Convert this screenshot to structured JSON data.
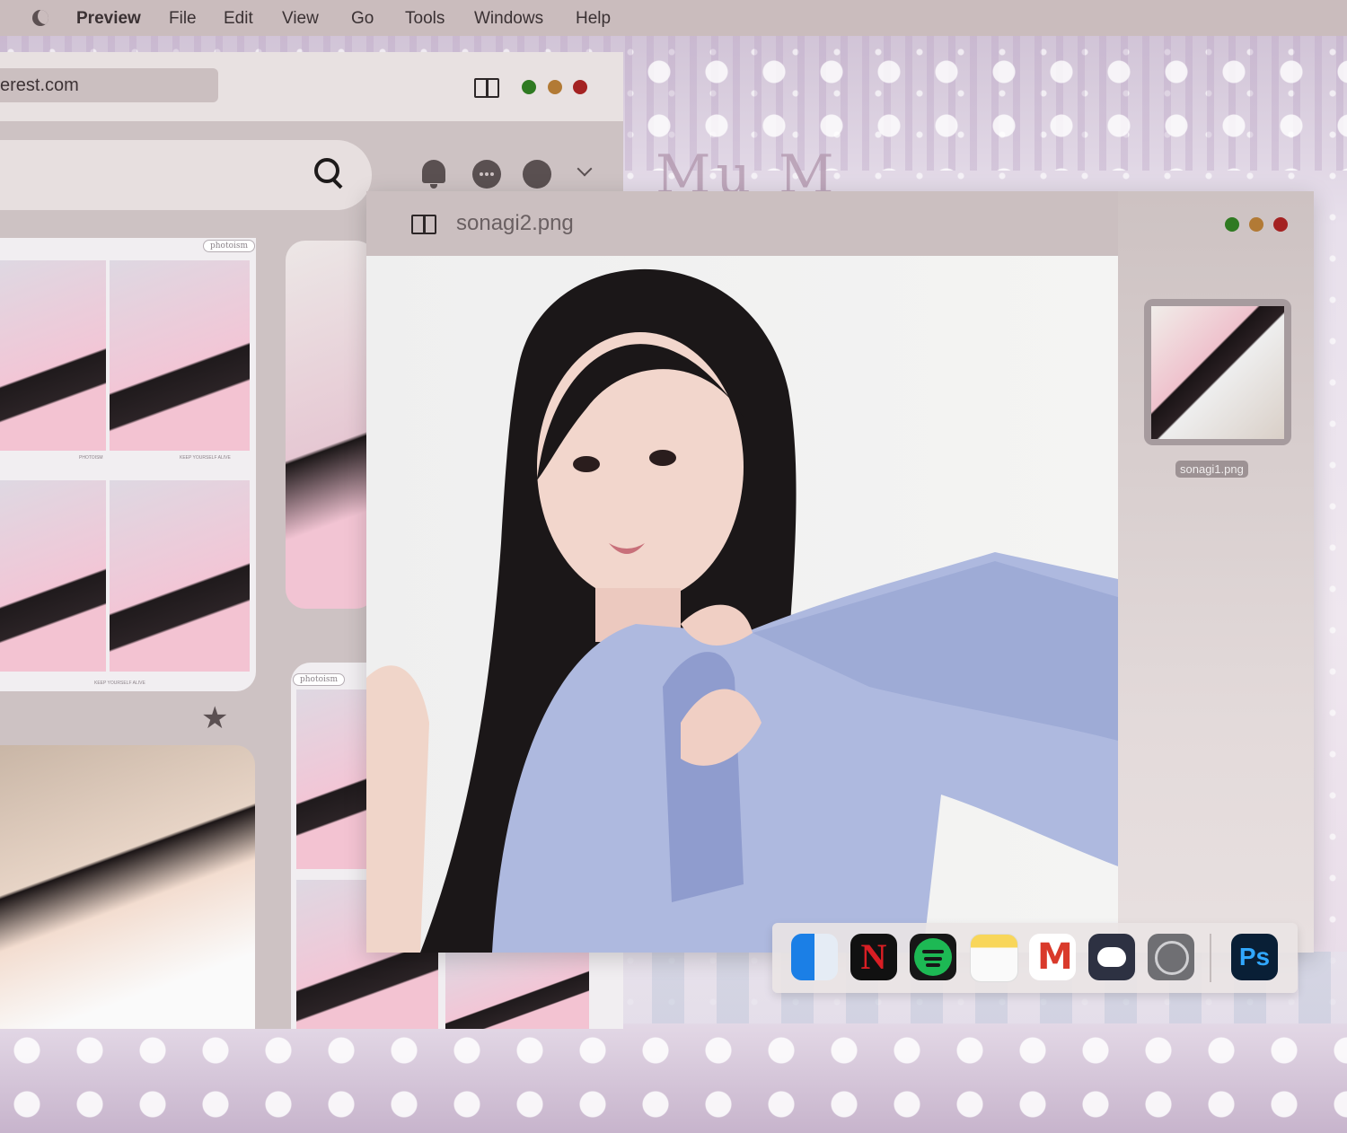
{
  "menubar": {
    "app_name": "Preview",
    "items": [
      "File",
      "Edit",
      "View",
      "Go",
      "Tools",
      "Windows",
      "Help"
    ]
  },
  "browser": {
    "url": "erest.com",
    "photoism_label_1": "photoism",
    "photoism_label_2": "photoism",
    "strip_caption_1": "KEEP YOURSELF ALIVE",
    "strip_caption_2": "PHOTOISM",
    "strip_caption_3": "KEEP YOURSELF ALIVE"
  },
  "preview": {
    "filename": "sonagi2.png",
    "thumbnails": [
      {
        "label": "sonagi1.png"
      }
    ]
  },
  "wallpaper": {
    "text": "Mu M"
  },
  "dock": {
    "apps": [
      {
        "name": "Finder",
        "icon": "finder-icon"
      },
      {
        "name": "Netflix",
        "icon": "netflix-icon",
        "glyph": "N"
      },
      {
        "name": "Spotify",
        "icon": "spotify-icon"
      },
      {
        "name": "Notes",
        "icon": "notes-icon"
      },
      {
        "name": "Gmail",
        "icon": "gmail-icon"
      },
      {
        "name": "Discord",
        "icon": "discord-icon"
      },
      {
        "name": "System Settings",
        "icon": "settings-icon"
      },
      {
        "name": "Photoshop",
        "icon": "photoshop-icon",
        "glyph": "Ps"
      }
    ]
  },
  "colors": {
    "close": "#a42222",
    "minimize": "#b27a35",
    "maximize": "#2f7a22",
    "menubar": "#cabcbd"
  }
}
